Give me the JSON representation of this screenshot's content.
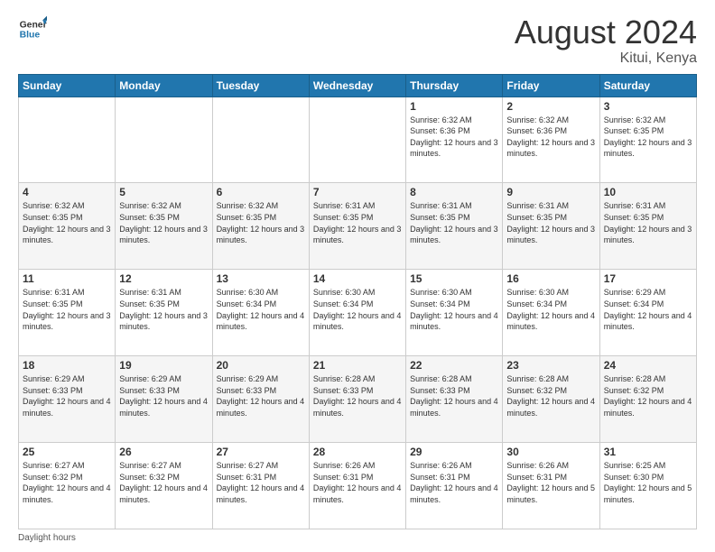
{
  "header": {
    "logo_line1": "General",
    "logo_line2": "Blue",
    "main_title": "August 2024",
    "sub_title": "Kitui, Kenya"
  },
  "calendar": {
    "days_of_week": [
      "Sunday",
      "Monday",
      "Tuesday",
      "Wednesday",
      "Thursday",
      "Friday",
      "Saturday"
    ],
    "weeks": [
      [
        {
          "day": "",
          "info": ""
        },
        {
          "day": "",
          "info": ""
        },
        {
          "day": "",
          "info": ""
        },
        {
          "day": "",
          "info": ""
        },
        {
          "day": "1",
          "info": "Sunrise: 6:32 AM\nSunset: 6:36 PM\nDaylight: 12 hours\nand 3 minutes."
        },
        {
          "day": "2",
          "info": "Sunrise: 6:32 AM\nSunset: 6:36 PM\nDaylight: 12 hours\nand 3 minutes."
        },
        {
          "day": "3",
          "info": "Sunrise: 6:32 AM\nSunset: 6:35 PM\nDaylight: 12 hours\nand 3 minutes."
        }
      ],
      [
        {
          "day": "4",
          "info": "Sunrise: 6:32 AM\nSunset: 6:35 PM\nDaylight: 12 hours\nand 3 minutes."
        },
        {
          "day": "5",
          "info": "Sunrise: 6:32 AM\nSunset: 6:35 PM\nDaylight: 12 hours\nand 3 minutes."
        },
        {
          "day": "6",
          "info": "Sunrise: 6:32 AM\nSunset: 6:35 PM\nDaylight: 12 hours\nand 3 minutes."
        },
        {
          "day": "7",
          "info": "Sunrise: 6:31 AM\nSunset: 6:35 PM\nDaylight: 12 hours\nand 3 minutes."
        },
        {
          "day": "8",
          "info": "Sunrise: 6:31 AM\nSunset: 6:35 PM\nDaylight: 12 hours\nand 3 minutes."
        },
        {
          "day": "9",
          "info": "Sunrise: 6:31 AM\nSunset: 6:35 PM\nDaylight: 12 hours\nand 3 minutes."
        },
        {
          "day": "10",
          "info": "Sunrise: 6:31 AM\nSunset: 6:35 PM\nDaylight: 12 hours\nand 3 minutes."
        }
      ],
      [
        {
          "day": "11",
          "info": "Sunrise: 6:31 AM\nSunset: 6:35 PM\nDaylight: 12 hours\nand 3 minutes."
        },
        {
          "day": "12",
          "info": "Sunrise: 6:31 AM\nSunset: 6:35 PM\nDaylight: 12 hours\nand 3 minutes."
        },
        {
          "day": "13",
          "info": "Sunrise: 6:30 AM\nSunset: 6:34 PM\nDaylight: 12 hours\nand 4 minutes."
        },
        {
          "day": "14",
          "info": "Sunrise: 6:30 AM\nSunset: 6:34 PM\nDaylight: 12 hours\nand 4 minutes."
        },
        {
          "day": "15",
          "info": "Sunrise: 6:30 AM\nSunset: 6:34 PM\nDaylight: 12 hours\nand 4 minutes."
        },
        {
          "day": "16",
          "info": "Sunrise: 6:30 AM\nSunset: 6:34 PM\nDaylight: 12 hours\nand 4 minutes."
        },
        {
          "day": "17",
          "info": "Sunrise: 6:29 AM\nSunset: 6:34 PM\nDaylight: 12 hours\nand 4 minutes."
        }
      ],
      [
        {
          "day": "18",
          "info": "Sunrise: 6:29 AM\nSunset: 6:33 PM\nDaylight: 12 hours\nand 4 minutes."
        },
        {
          "day": "19",
          "info": "Sunrise: 6:29 AM\nSunset: 6:33 PM\nDaylight: 12 hours\nand 4 minutes."
        },
        {
          "day": "20",
          "info": "Sunrise: 6:29 AM\nSunset: 6:33 PM\nDaylight: 12 hours\nand 4 minutes."
        },
        {
          "day": "21",
          "info": "Sunrise: 6:28 AM\nSunset: 6:33 PM\nDaylight: 12 hours\nand 4 minutes."
        },
        {
          "day": "22",
          "info": "Sunrise: 6:28 AM\nSunset: 6:33 PM\nDaylight: 12 hours\nand 4 minutes."
        },
        {
          "day": "23",
          "info": "Sunrise: 6:28 AM\nSunset: 6:32 PM\nDaylight: 12 hours\nand 4 minutes."
        },
        {
          "day": "24",
          "info": "Sunrise: 6:28 AM\nSunset: 6:32 PM\nDaylight: 12 hours\nand 4 minutes."
        }
      ],
      [
        {
          "day": "25",
          "info": "Sunrise: 6:27 AM\nSunset: 6:32 PM\nDaylight: 12 hours\nand 4 minutes."
        },
        {
          "day": "26",
          "info": "Sunrise: 6:27 AM\nSunset: 6:32 PM\nDaylight: 12 hours\nand 4 minutes."
        },
        {
          "day": "27",
          "info": "Sunrise: 6:27 AM\nSunset: 6:31 PM\nDaylight: 12 hours\nand 4 minutes."
        },
        {
          "day": "28",
          "info": "Sunrise: 6:26 AM\nSunset: 6:31 PM\nDaylight: 12 hours\nand 4 minutes."
        },
        {
          "day": "29",
          "info": "Sunrise: 6:26 AM\nSunset: 6:31 PM\nDaylight: 12 hours\nand 4 minutes."
        },
        {
          "day": "30",
          "info": "Sunrise: 6:26 AM\nSunset: 6:31 PM\nDaylight: 12 hours\nand 5 minutes."
        },
        {
          "day": "31",
          "info": "Sunrise: 6:25 AM\nSunset: 6:30 PM\nDaylight: 12 hours\nand 5 minutes."
        }
      ]
    ]
  },
  "footer": {
    "text": "Daylight hours"
  }
}
